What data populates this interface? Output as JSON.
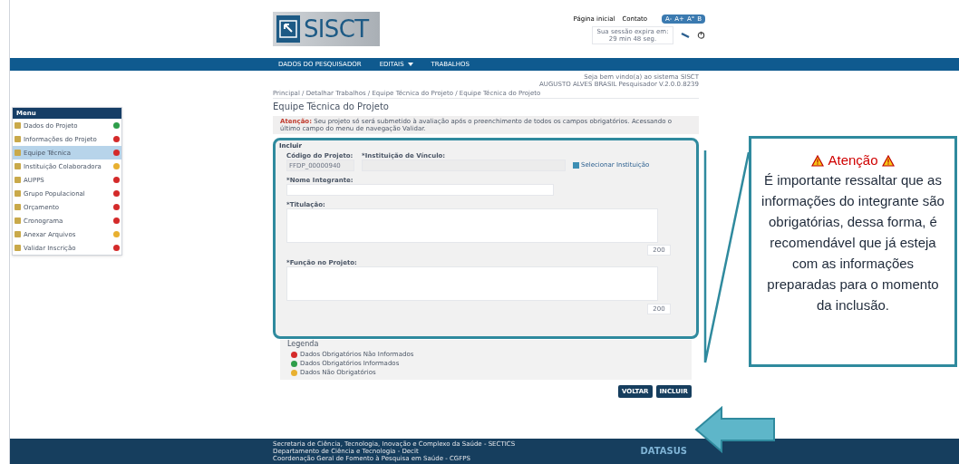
{
  "header": {
    "logo": "SISCT",
    "links": [
      "Página inicial",
      "Contato"
    ],
    "font_sizes": [
      "A-",
      "A+",
      "A°",
      "B"
    ],
    "session": "Sua sessão expira em: 29 min 48 seg."
  },
  "nav": [
    {
      "label": "DADOS DO PESQUISADOR",
      "dropdown": false
    },
    {
      "label": "EDITAIS",
      "dropdown": true
    },
    {
      "label": "TRABALHOS",
      "dropdown": false
    }
  ],
  "welcome": [
    "Seja bem vindo(a) ao sistema SISCT",
    "AUGUSTO ALVES BRASIL Pesquisador V.2.0.0.8239"
  ],
  "breadcrumb": "Principal / Detalhar Trabalhos / Equipe Técnica do Projeto / Equipe Técnica do Projeto",
  "page_title": "Equipe Técnica do Projeto",
  "alert": {
    "label": "Atenção:",
    "text": "Seu projeto só será submetido à avaliação após o preenchimento de todos os campos obrigatórios. Acessando o último campo do menu de navegação Validar."
  },
  "sidebar": {
    "title": "Menu",
    "items": [
      {
        "label": "Dados do Projeto",
        "color": "#2e9e4a",
        "selected": false
      },
      {
        "label": "Informações do Projeto",
        "color": "#d42a2a",
        "selected": false
      },
      {
        "label": "Equipe Técnica",
        "color": "#d42a2a",
        "selected": true
      },
      {
        "label": "Instituição Colaboradora",
        "color": "#e8b030",
        "selected": false
      },
      {
        "label": "AUPPS",
        "color": "#d42a2a",
        "selected": false
      },
      {
        "label": "Grupo Populacional",
        "color": "#d42a2a",
        "selected": false
      },
      {
        "label": "Orçamento",
        "color": "#d42a2a",
        "selected": false
      },
      {
        "label": "Cronograma",
        "color": "#d42a2a",
        "selected": false
      },
      {
        "label": "Anexar Arquivos",
        "color": "#e8b030",
        "selected": false
      },
      {
        "label": "Validar Inscrição",
        "color": "#d42a2a",
        "selected": false
      }
    ]
  },
  "form": {
    "title": "Incluir",
    "code_label": "Código do Projeto:",
    "code_value": "FFDP_00000940",
    "institution_label": "*Instituição de Vínculo:",
    "select_link": "Selecionar Instituição",
    "name_label": "*Nome Integrante:",
    "education_label": "*Titulação:",
    "education_counter": "200",
    "role_label": "*Função no Projeto:",
    "role_counter": "200"
  },
  "legend": {
    "title": "Legenda",
    "items": [
      {
        "label": "Dados Obrigatórios Não Informados",
        "color": "#d42a2a"
      },
      {
        "label": "Dados Obrigatórios Informados",
        "color": "#2e9e4a"
      },
      {
        "label": "Dados Não Obrigatórios",
        "color": "#e8b030"
      }
    ]
  },
  "buttons": [
    "VOLTAR",
    "INCLUIR"
  ],
  "footer": {
    "lines": [
      "Secretaria de Ciência, Tecnologia, Inovação e Complexo da Saúde - SECTICS",
      "Departamento de Ciência e Tecnologia - Decit",
      "Coordenação Geral de Fomento à Pesquisa em Saúde - CGFPS"
    ],
    "logo": "DATASUS"
  },
  "callout": {
    "title": "Atenção",
    "text": "É importante ressaltar que as informações do integrante são obrigatórias, dessa forma, é recomendável que já esteja com as informações preparadas para o momento da inclusão."
  }
}
